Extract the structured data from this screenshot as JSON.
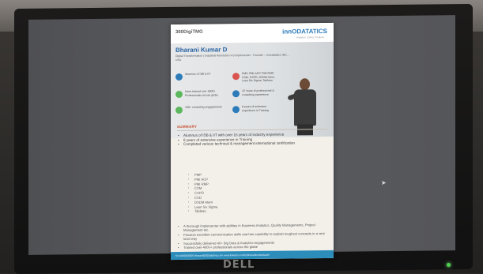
{
  "monitor": {
    "brand": "DELL",
    "power_color": "#4fd24f"
  },
  "document": {
    "header": {
      "logo_left": "360DigiTMG",
      "logo_right": "innODATATICS",
      "logo_right_sub": "Analytics | Data | Products"
    },
    "profile": {
      "name": "Bharani Kumar D",
      "subtitle": "Digital Transformation | Industrial Revolution 4.0 Implementer · Founder – Innodatatics INC., USA",
      "badges": [
        {
          "text": "Alumnus of ISB & IIT",
          "color": "#2d7bb9"
        },
        {
          "text": "PMP, PMI-ACP, PMI-RMP, CSM, CSPO, DSDM Atern, Lean Six Sigma, Tableau",
          "color": "#d9534f"
        },
        {
          "text": "Have trained over 4000+ Professionals across globe",
          "color": "#5cb85c"
        },
        {
          "text": "15 Years of professional & consulting experience",
          "color": "#2d7bb9"
        },
        {
          "text": "100+ consulting engagements",
          "color": "#5cb85c"
        },
        {
          "text": "8 years of extensive experience in Training",
          "color": "#2d7bb9"
        }
      ]
    },
    "summary": {
      "heading": "SUMMARY",
      "bullets": [
        "Alumnus of ISB & IIT with over 15 years of industry experience",
        "8 years of extensive experience in Training",
        "Completed various technical & management international certification"
      ],
      "certifications": [
        "PMP",
        "PMI ACP",
        "PMI RMP",
        "CSM",
        "CSPO",
        "CSD",
        "DSDM Atern",
        "Lean Six Sigma",
        "Tableau"
      ],
      "more_bullets": [
        "A thorough implementer with abilities in Business Analytics, Quality Managements, Project Management etc.",
        "Possess excellent communication skills and has capability to explain toughest concepts in a very lucid way",
        "Successfully delivered 40+ Big Data & Analytics engagements",
        "Trained over 4000+ professionals across the globe"
      ]
    },
    "footer": "+91 9849208000   bharani@360digitmg.com   www.linkedin.com/in/bharanikumardasari",
    "colors": {
      "accent": "#2d7bb9",
      "summary_heading": "#c64a2a",
      "footer_bg": "#2c8cba"
    }
  }
}
